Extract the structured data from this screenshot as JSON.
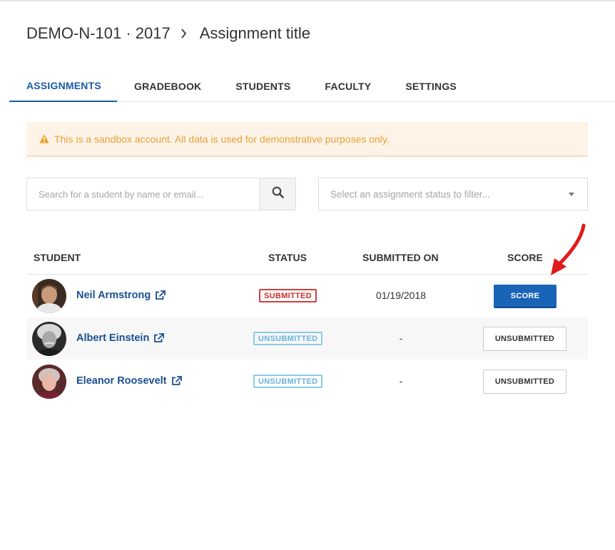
{
  "breadcrumb": {
    "course": "DEMO-N-101 · 2017",
    "assignment": "Assignment title"
  },
  "tabs": [
    {
      "label": "ASSIGNMENTS",
      "active": true
    },
    {
      "label": "GRADEBOOK",
      "active": false
    },
    {
      "label": "STUDENTS",
      "active": false
    },
    {
      "label": "FACULTY",
      "active": false
    },
    {
      "label": "SETTINGS",
      "active": false
    }
  ],
  "alert": {
    "text": "This is a sandbox account. All data is used for demonstrative purposes only.",
    "icon": "warning-icon"
  },
  "search": {
    "placeholder": "Search for a student by name or email...",
    "value": "",
    "icon": "search-icon"
  },
  "filter": {
    "placeholder": "Select an assignment status to filter..."
  },
  "table": {
    "headers": {
      "student": "STUDENT",
      "status": "STATUS",
      "submitted_on": "SUBMITTED ON",
      "score": "SCORE"
    },
    "rows": [
      {
        "name": "Neil Armstrong",
        "status": "SUBMITTED",
        "submitted_on": "01/19/2018",
        "action": "SCORE"
      },
      {
        "name": "Albert Einstein",
        "status": "UNSUBMITTED",
        "submitted_on": "-",
        "action": "UNSUBMITTED"
      },
      {
        "name": "Eleanor Roosevelt",
        "status": "UNSUBMITTED",
        "submitted_on": "-",
        "action": "UNSUBMITTED"
      }
    ]
  },
  "colors": {
    "accent": "#1a5aa5",
    "primary_button": "#1a64b8",
    "submitted": "#d43d3d",
    "unsubmitted": "#8ec9e6",
    "alert_text": "#e8a13a",
    "annotation_arrow": "#e01b1b"
  }
}
